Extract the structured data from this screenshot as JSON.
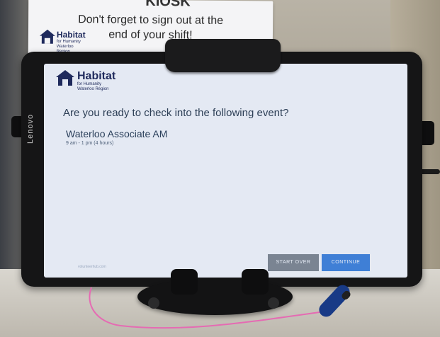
{
  "sign": {
    "top_fragment": "KIOSK",
    "line1": "Don't forget to sign out at the",
    "line2": "end of your shift!",
    "logo_name": "Habitat",
    "logo_sub1": "for Humanity",
    "logo_sub2": "Waterloo Region"
  },
  "tablet": {
    "brand": "Lenovo",
    "screen": {
      "logo_name": "Habitat",
      "logo_sub1": "for Humanity",
      "logo_sub2": "Waterloo Region",
      "question": "Are you ready to check into the following event?",
      "event_name": "Waterloo Associate AM",
      "event_time": "9 am - 1 pm (4 hours)",
      "footer_url": "volunteerhub.com",
      "buttons": {
        "start_over": "START OVER",
        "continue": "CONTINUE"
      }
    }
  },
  "colors": {
    "screen_bg": "#e4e9f3",
    "logo_blue": "#1f2a5c",
    "start_over_btn": "#7a8492",
    "continue_btn": "#3f7fd6",
    "stylus_string": "#e56bb3"
  },
  "icons": {
    "house_logo": "house-icon"
  }
}
